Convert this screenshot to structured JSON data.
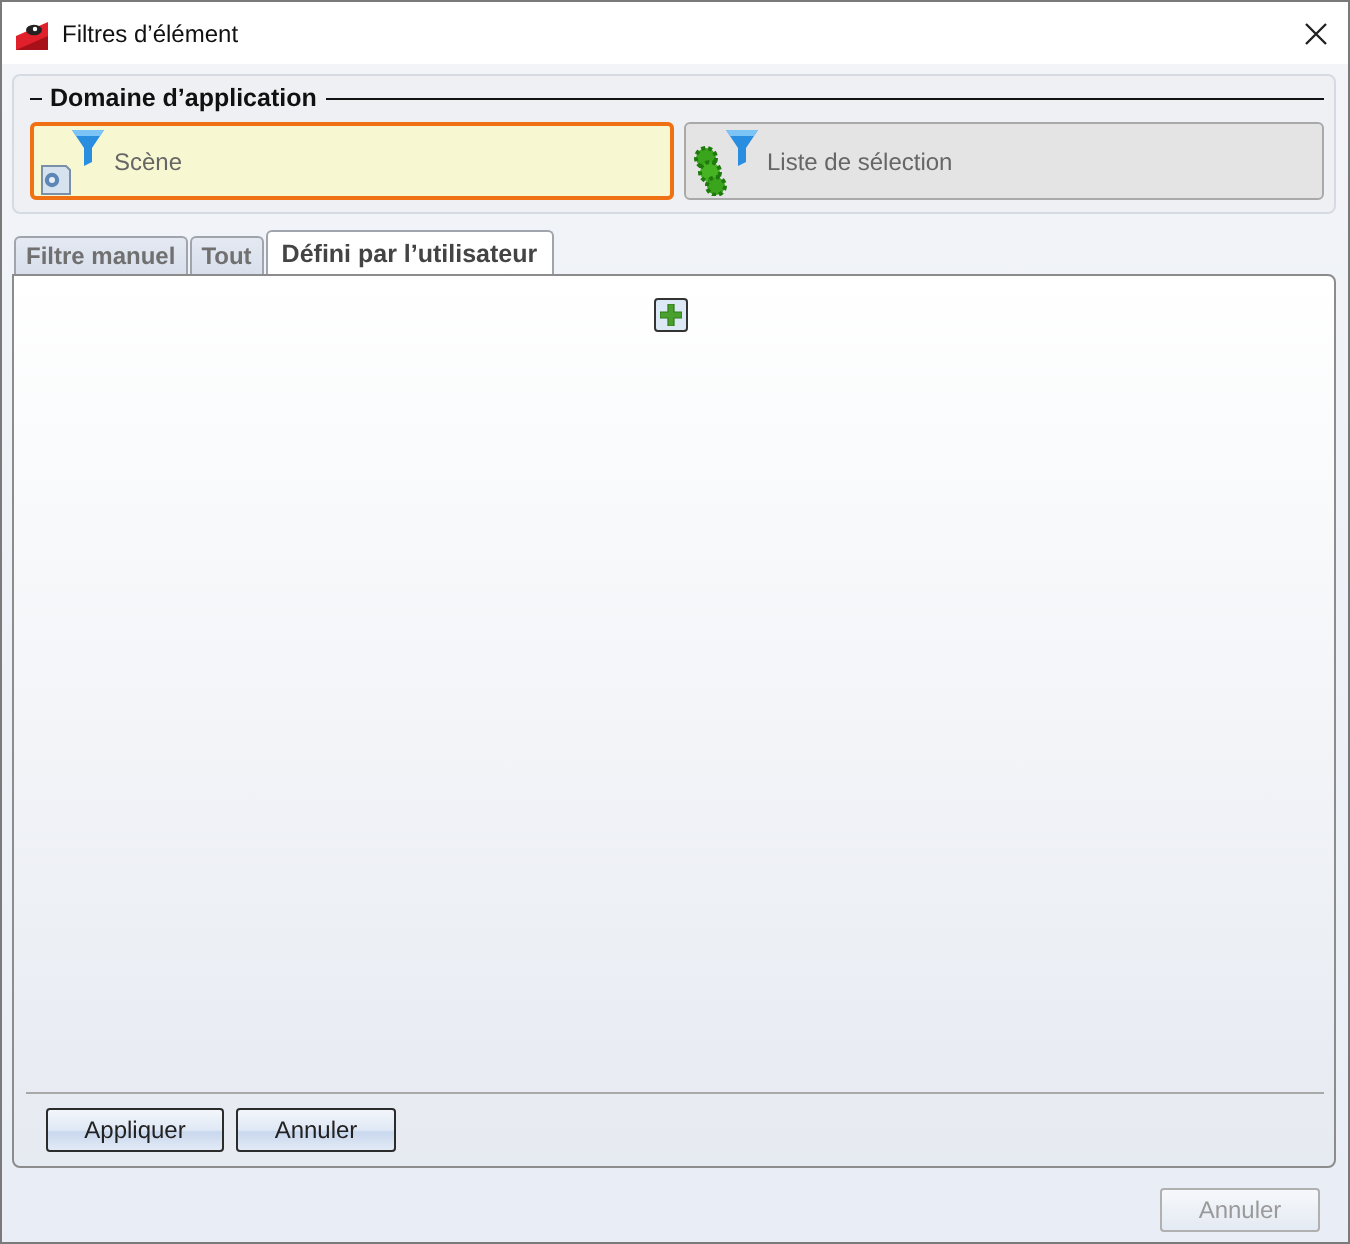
{
  "window": {
    "title": "Filtres d’élément"
  },
  "application_domain": {
    "heading": "Domaine d’application",
    "options": [
      {
        "label": "Scène",
        "kind": "scene",
        "selected": true
      },
      {
        "label": "Liste de sélection",
        "kind": "list",
        "selected": false
      }
    ]
  },
  "tabs": [
    {
      "label": "Filtre manuel",
      "selected": false
    },
    {
      "label": "Tout",
      "selected": false
    },
    {
      "label": "Défini par l’utilisateur",
      "selected": true
    }
  ],
  "panel": {
    "buttons": [
      {
        "label": "Appliquer",
        "disabled": false
      },
      {
        "label": "Annuler",
        "disabled": false
      }
    ]
  },
  "footer": {
    "buttons": [
      {
        "label": "Annuler",
        "disabled": true
      }
    ]
  }
}
